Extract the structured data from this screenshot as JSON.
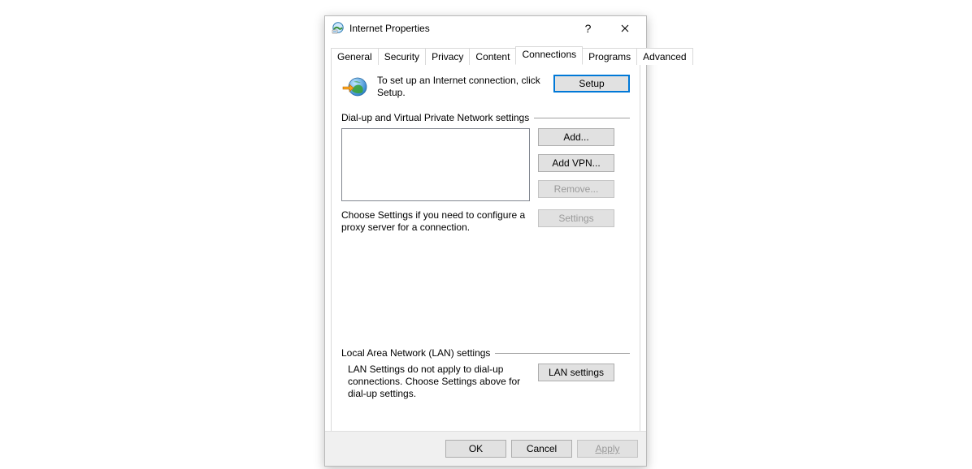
{
  "window": {
    "title": "Internet Properties"
  },
  "tabs": {
    "general": "General",
    "security": "Security",
    "privacy": "Privacy",
    "content": "Content",
    "connections": "Connections",
    "programs": "Programs",
    "advanced": "Advanced"
  },
  "setup_section": {
    "text": "To set up an Internet connection, click Setup.",
    "button": "Setup"
  },
  "dialup_section": {
    "header": "Dial-up and Virtual Private Network settings",
    "add": "Add...",
    "add_vpn": "Add VPN...",
    "remove": "Remove...",
    "settings_text": "Choose Settings if you need to configure a proxy server for a connection.",
    "settings_btn": "Settings"
  },
  "lan_section": {
    "header": "Local Area Network (LAN) settings",
    "text": "LAN Settings do not apply to dial-up connections. Choose Settings above for dial-up settings.",
    "button": "LAN settings"
  },
  "footer": {
    "ok": "OK",
    "cancel": "Cancel",
    "apply": "Apply"
  }
}
